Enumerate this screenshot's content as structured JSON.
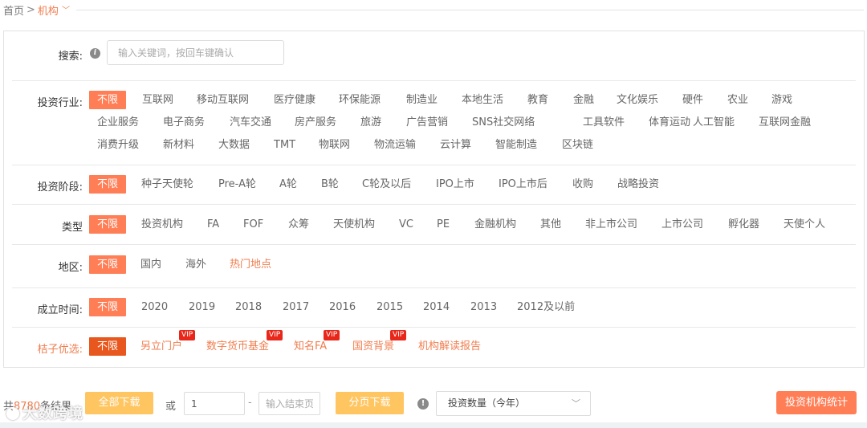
{
  "breadcrumb": {
    "home": "首页",
    "separator": ">",
    "current": "机构"
  },
  "filters": {
    "search": {
      "label": "搜索:",
      "placeholder": "输入关键词，按回车键确认"
    },
    "industry": {
      "label": "投资行业:",
      "all": "不限",
      "options": [
        "互联网",
        "移动互联网",
        "医疗健康",
        "环保能源",
        "制造业",
        "本地生活",
        "教育",
        "金融",
        "文化娱乐",
        "硬件",
        "农业",
        "游戏",
        "企业服务",
        "电子商务",
        "汽车交通",
        "房产服务",
        "旅游",
        "广告营销",
        "SNS社交网络",
        "工具软件",
        "体育运动",
        "人工智能",
        "互联网金融",
        "消费升级",
        "新材料",
        "大数据",
        "TMT",
        "物联网",
        "物流运输",
        "云计算",
        "智能制造",
        "区块链"
      ]
    },
    "stage": {
      "label": "投资阶段:",
      "all": "不限",
      "options": [
        "种子天使轮",
        "Pre-A轮",
        "A轮",
        "B轮",
        "C轮及以后",
        "IPO上市",
        "IPO上市后",
        "收购",
        "战略投资"
      ]
    },
    "type": {
      "label": "类型",
      "all": "不限",
      "options": [
        "投资机构",
        "FA",
        "FOF",
        "众筹",
        "天使机构",
        "VC",
        "PE",
        "金融机构",
        "其他",
        "非上市公司",
        "上市公司",
        "孵化器",
        "天使个人"
      ]
    },
    "region": {
      "label": "地区:",
      "all": "不限",
      "options": [
        "国内",
        "海外"
      ],
      "hot": "热门地点"
    },
    "founded": {
      "label": "成立时间:",
      "all": "不限",
      "options": [
        "2020",
        "2019",
        "2018",
        "2017",
        "2016",
        "2015",
        "2014",
        "2013",
        "2012及以前"
      ]
    },
    "premium": {
      "label": "桔子优选:",
      "all": "不限",
      "options": [
        "另立门户",
        "数字货币基金",
        "知名FA",
        "国资背景",
        "机构解读报告"
      ],
      "vip_badge": "VIP"
    }
  },
  "toolbar": {
    "result_prefix": "共",
    "result_count": "8780",
    "result_suffix": "条结果",
    "download_all": "全部下载",
    "or": "或",
    "page_start_value": "1",
    "dash": "-",
    "page_end_placeholder": "输入结束页",
    "download_page": "分页下载",
    "sort_value": "投资数量（今年）",
    "stats_button": "投资机构统计"
  },
  "watermark": "大数跨境",
  "colors": {
    "accent": "#ff7e56",
    "accent_dark": "#e8571d",
    "link_orange": "#f07e4f",
    "vip_red": "#e8271a",
    "download_yellow": "#ffc561"
  }
}
